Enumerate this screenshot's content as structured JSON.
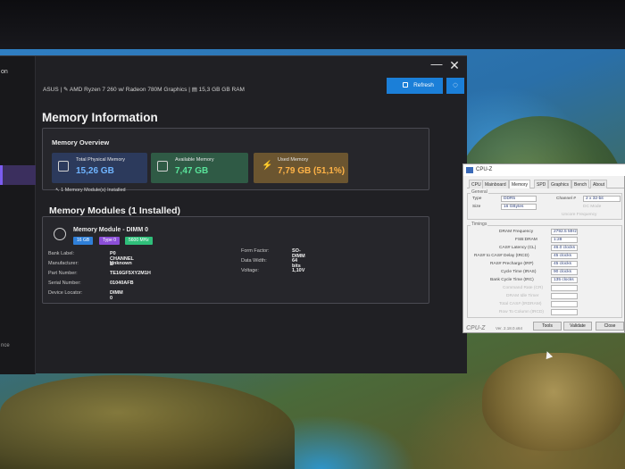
{
  "app": {
    "sidebar_title": "on",
    "sidebar_tail": "nce",
    "sysinfo": "ASUS | ✎ AMD Ryzen 7 260 w/ Radeon 780M Graphics | ▤ 15,3 GB GB RAM",
    "refresh_label": "Refresh",
    "minimize_glyph": "—",
    "close_glyph": "✕",
    "cycle_glyph": "◌",
    "page_title": "Memory Information"
  },
  "overview": {
    "title": "Memory Overview",
    "total_label": "Total Physical Memory",
    "total_value": "15,26 GB",
    "available_label": "Available Memory",
    "available_value": "7,47 GB",
    "used_label": "Used Memory",
    "used_value": "7,79 GB (51,1%)",
    "used_glyph": "⚡",
    "installed_note": "↖ 1 Memory Module(s) Installed"
  },
  "modules": {
    "title": "Memory Modules (1 Installed)",
    "items": [
      {
        "name": "Memory Module - DIMM 0",
        "badge_size": "16 GB",
        "badge_type": "Type 0",
        "badge_speed": "5600 MHz",
        "left_fields": [
          {
            "key": "Bank Label:",
            "value": "P0 CHANNEL B"
          },
          {
            "key": "Manufacturer:",
            "value": "Unknown"
          },
          {
            "key": "Part Number:",
            "value": "TE16GF5XY2M1H"
          },
          {
            "key": "Serial Number:",
            "value": "01040AFB"
          },
          {
            "key": "Device Locator:",
            "value": "DIMM 0"
          }
        ],
        "right_fields": [
          {
            "key": "Form Factor:",
            "value": "SO-DIMM"
          },
          {
            "key": "Data Width:",
            "value": "64 bits"
          },
          {
            "key": "Voltage:",
            "value": "1,10V"
          }
        ]
      }
    ]
  },
  "cpuz": {
    "title": "CPU-Z",
    "tabs": [
      "CPU",
      "Mainboard",
      "Memory",
      "SPD",
      "Graphics",
      "Bench",
      "About"
    ],
    "active_tab": "Memory",
    "general_label": "General",
    "type_label": "Type",
    "type_value": "DDR5",
    "size_label": "Size",
    "size_value": "16 GBytes",
    "channel_label": "Channel #",
    "channel_value": "2 x 32-bit",
    "dc_mode_label": "DC Mode",
    "uncore_label": "Uncore Frequency",
    "timings_label": "Timings",
    "timings": [
      {
        "label": "DRAM Frequency",
        "value": "2792.5 MHz"
      },
      {
        "label": "FSB:DRAM",
        "value": "1:28"
      },
      {
        "label": "CAS# Latency (CL)",
        "value": "46.0 clocks"
      },
      {
        "label": "RAS# to CAS# Delay (tRCD)",
        "value": "45 clocks"
      },
      {
        "label": "RAS# Precharge (tRP)",
        "value": "45 clocks"
      },
      {
        "label": "Cycle Time (tRAS)",
        "value": "90 clocks"
      },
      {
        "label": "Bank Cycle Time (tRC)",
        "value": "135 clocks"
      }
    ],
    "timings_dim": [
      "Command Rate (CR)",
      "DRAM Idle Timer",
      "Total CAS# (tRDRAM)",
      "Row To Column (tRCD)"
    ],
    "footer_logo": "CPU-Z",
    "version": "Ver. 2.18.0.x64",
    "tools_label": "Tools",
    "validate_label": "Validate",
    "close_label": "Close"
  }
}
